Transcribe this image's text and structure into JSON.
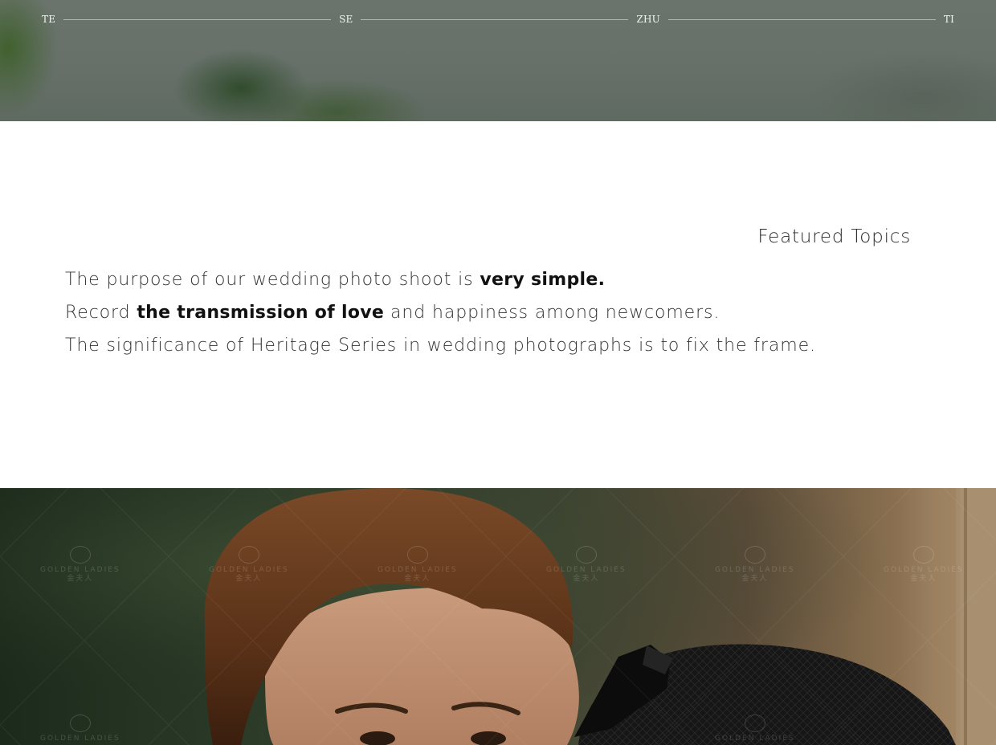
{
  "hero": {
    "nav": [
      "TE",
      "SE",
      "ZHU",
      "TI"
    ]
  },
  "featured": {
    "title": "Featured Topics",
    "lines": [
      {
        "parts": [
          "The purpose of our wedding photo shoot is ",
          "very simple."
        ]
      },
      {
        "parts": [
          "Record ",
          "the transmission of love",
          " and happiness among newcomers."
        ]
      },
      {
        "parts": [
          "The significance of Heritage Series in wedding photographs is to fix the frame."
        ]
      }
    ]
  },
  "photo": {
    "watermark_text": "GOLDEN LADIES",
    "watermark_sub": "金夫人"
  },
  "colors": {
    "hero_bg": "#67716a",
    "text": "#333333",
    "text_bold": "#111111",
    "photo_dark": "#1c2a1c"
  }
}
